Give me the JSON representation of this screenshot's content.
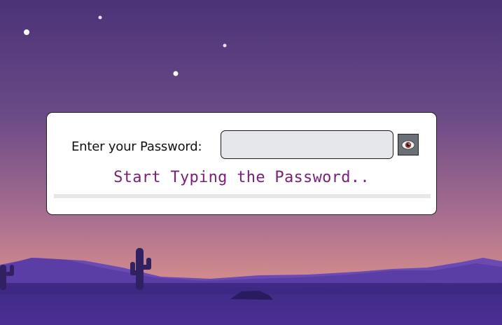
{
  "password_prompt": {
    "label": "Enter your Password:",
    "input_value": "",
    "input_placeholder": "",
    "status_text": "Start Typing the Password..",
    "strength_level": 0
  },
  "icons": {
    "toggle_visibility": "eye-icon"
  },
  "colors": {
    "status_text": "#7a1f7a",
    "input_background": "#e6e7ea",
    "sky_top": "#4b3278",
    "sky_bottom": "#d08a8e",
    "ground": "#4a2c8a"
  }
}
